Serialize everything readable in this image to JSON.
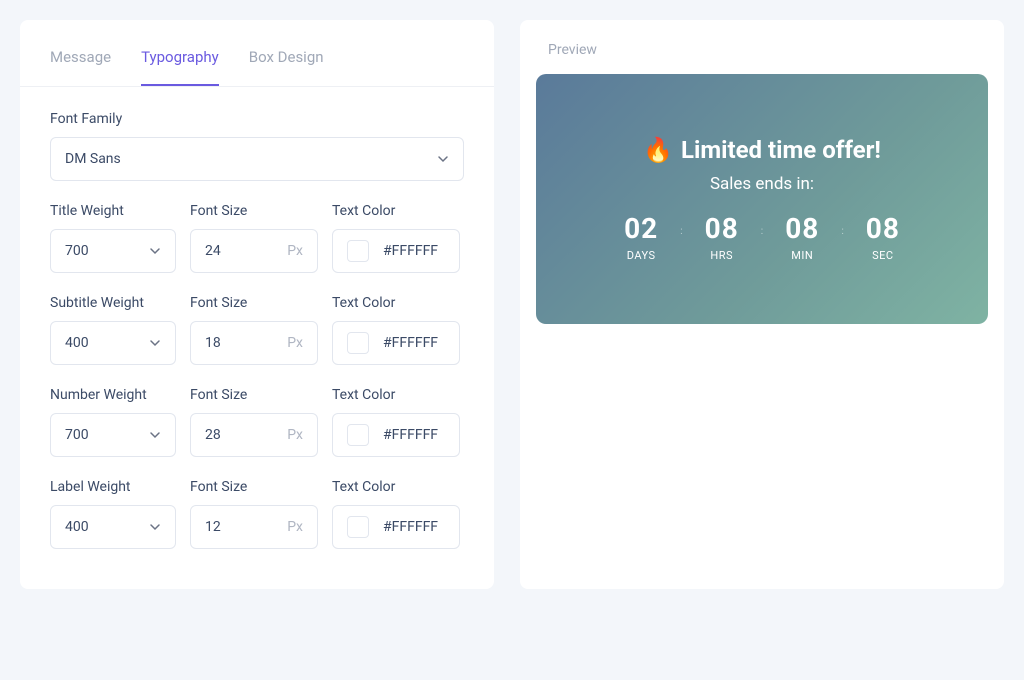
{
  "tabs": [
    "Message",
    "Typography",
    "Box Design"
  ],
  "activeTab": 1,
  "form": {
    "fontFamily": {
      "label": "Font Family",
      "value": "DM Sans"
    },
    "rows": [
      {
        "weightLabel": "Title Weight",
        "weight": "700",
        "sizeLabel": "Font Size",
        "size": "24",
        "sizeUnit": "Px",
        "colorLabel": "Text Color",
        "color": "#FFFFFF"
      },
      {
        "weightLabel": "Subtitle Weight",
        "weight": "400",
        "sizeLabel": "Font Size",
        "size": "18",
        "sizeUnit": "Px",
        "colorLabel": "Text Color",
        "color": "#FFFFFF"
      },
      {
        "weightLabel": "Number Weight",
        "weight": "700",
        "sizeLabel": "Font Size",
        "size": "28",
        "sizeUnit": "Px",
        "colorLabel": "Text Color",
        "color": "#FFFFFF"
      },
      {
        "weightLabel": "Label Weight",
        "weight": "400",
        "sizeLabel": "Font Size",
        "size": "12",
        "sizeUnit": "Px",
        "colorLabel": "Text Color",
        "color": "#FFFFFF"
      }
    ]
  },
  "preview": {
    "label": "Preview",
    "titleEmoji": "🔥",
    "title": "Limited time offer!",
    "subtitle": "Sales ends in:",
    "segments": [
      {
        "num": "02",
        "lab": "DAYS"
      },
      {
        "num": "08",
        "lab": "HRS"
      },
      {
        "num": "08",
        "lab": "MIN"
      },
      {
        "num": "08",
        "lab": "SEC"
      }
    ]
  }
}
